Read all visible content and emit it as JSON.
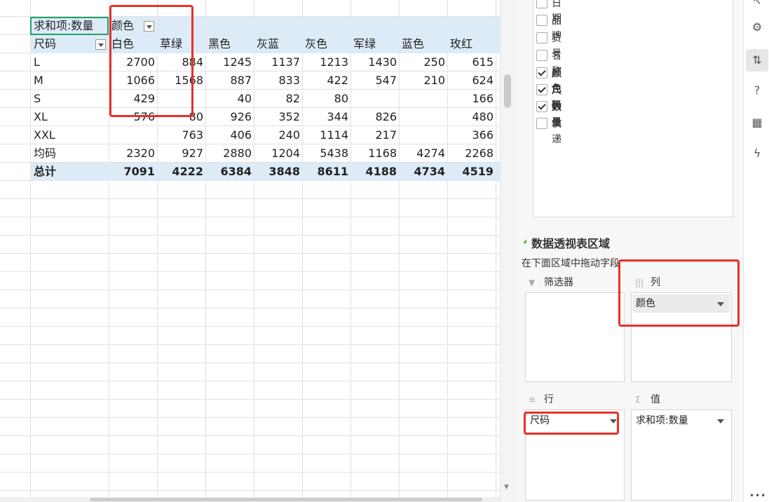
{
  "pivot": {
    "header_value_label": "求和项:数量",
    "col_field_label": "颜色",
    "row_field_label": "尺码",
    "columns": [
      "白色",
      "草绿",
      "黑色",
      "灰蓝",
      "灰色",
      "军绿",
      "蓝色",
      "玫红"
    ],
    "rows": [
      {
        "label": "L",
        "cells": [
          "2700",
          "884",
          "1245",
          "1137",
          "1213",
          "1430",
          "250",
          "615"
        ]
      },
      {
        "label": "M",
        "cells": [
          "1066",
          "1568",
          "887",
          "833",
          "422",
          "547",
          "210",
          "624"
        ]
      },
      {
        "label": "S",
        "cells": [
          "429",
          "",
          "40",
          "82",
          "80",
          "",
          "",
          "166"
        ]
      },
      {
        "label": "XL",
        "cells": [
          "576",
          "80",
          "926",
          "352",
          "344",
          "826",
          "",
          "480"
        ]
      },
      {
        "label": "XXL",
        "cells": [
          "",
          "763",
          "406",
          "240",
          "1114",
          "217",
          "",
          "366"
        ]
      },
      {
        "label": "均码",
        "cells": [
          "2320",
          "927",
          "2880",
          "1204",
          "5438",
          "1168",
          "4274",
          "2268"
        ]
      }
    ],
    "total": {
      "label": "总计",
      "cells": [
        "7091",
        "4222",
        "6384",
        "3848",
        "8611",
        "4188",
        "4734",
        "4519"
      ]
    }
  },
  "panel": {
    "fields": [
      {
        "label": "日期",
        "checked": false
      },
      {
        "label": "品牌",
        "checked": false
      },
      {
        "label": "货号",
        "checked": false
      },
      {
        "label": "名称",
        "checked": false
      },
      {
        "label": "颜色",
        "checked": true
      },
      {
        "label": "尺码",
        "checked": true
      },
      {
        "label": "数量",
        "checked": true
      },
      {
        "label": "快递",
        "checked": false
      }
    ],
    "areas_title": "数据透视表区域",
    "areas_hint": "在下面区域中拖动字段",
    "filter_label": "筛选器",
    "columns_label": "列",
    "columns_item": "颜色",
    "rows_label": "行",
    "rows_item": "尺码",
    "values_label": "值",
    "values_item": "求和项:数量"
  },
  "colors": {
    "band": "#ddebf7",
    "selection": "#21a366",
    "highlight": "#e8302a"
  },
  "icons": [
    "filter-icon",
    "columns-icon",
    "rows-icon",
    "sigma-icon",
    "help-icon",
    "pivot-icon",
    "lightning-icon",
    "more-icon"
  ]
}
